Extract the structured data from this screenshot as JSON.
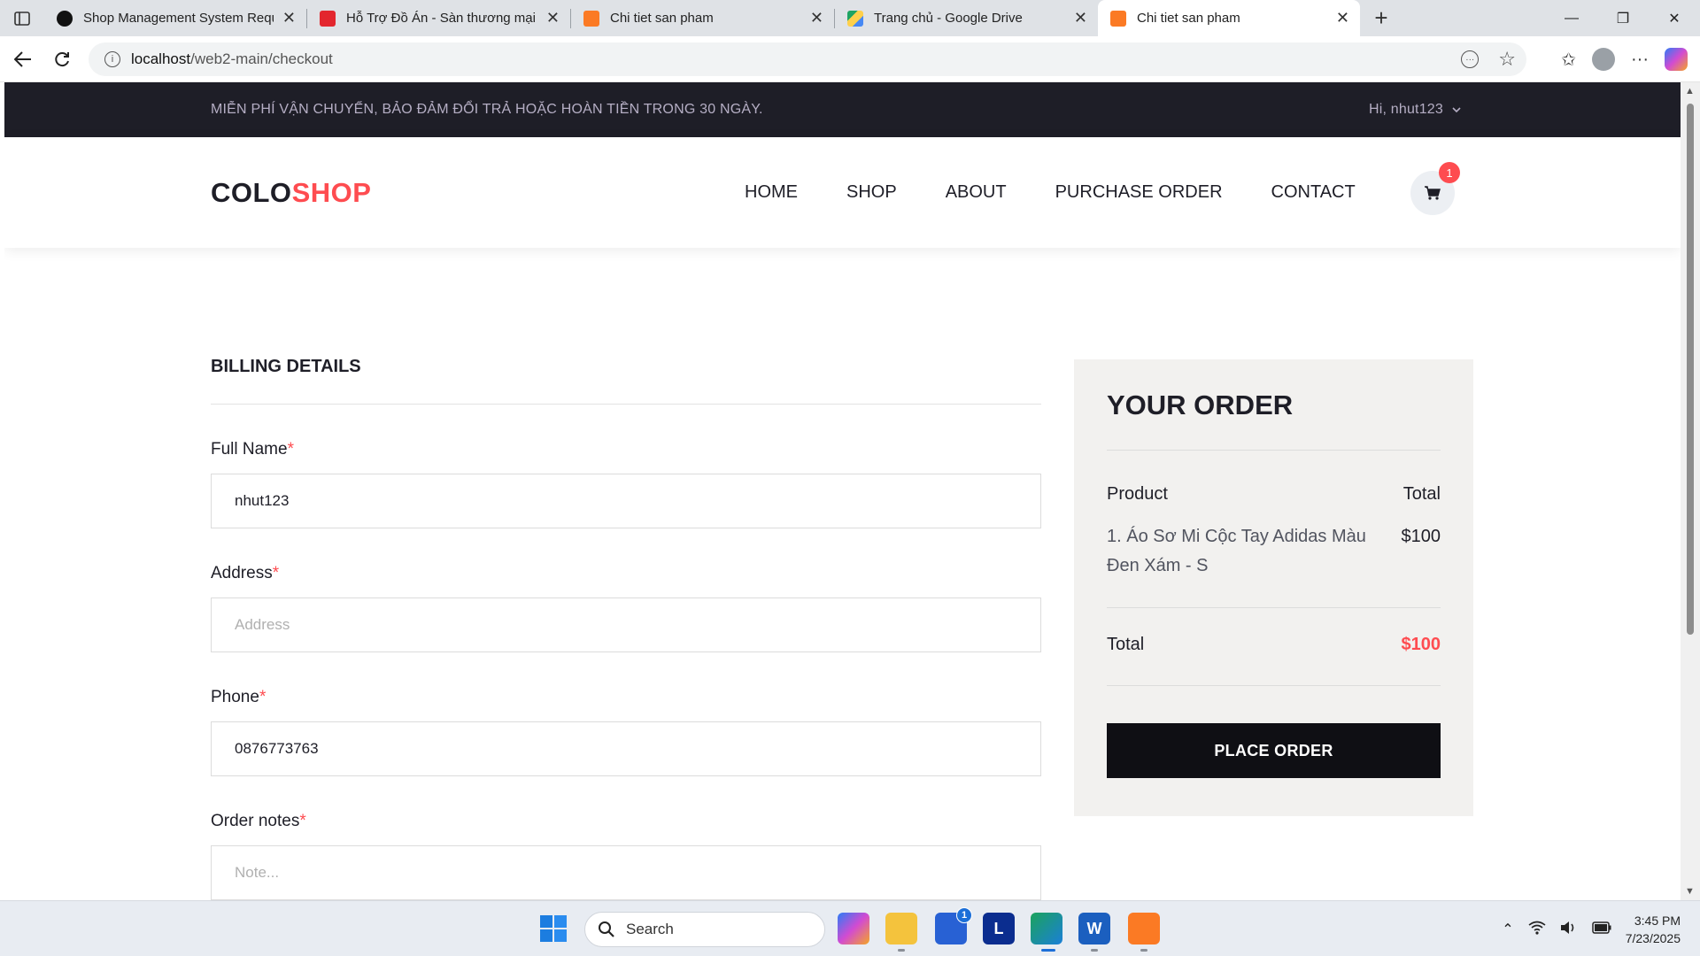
{
  "browser": {
    "tabs": [
      {
        "title": "Shop Management System Requi",
        "favicon_color": "#111111",
        "active": false
      },
      {
        "title": "Hỗ Trợ Đồ Án - Sàn thương mại b",
        "favicon_color": "#e3262e",
        "active": false
      },
      {
        "title": "Chi tiet san pham",
        "favicon_color": "#fb7a24",
        "active": false
      },
      {
        "title": "Trang chủ - Google Drive",
        "favicon_color": "#1fa463",
        "active": false
      },
      {
        "title": "Chi tiet san pham",
        "favicon_color": "#fb7a24",
        "active": true
      }
    ],
    "url_host": "localhost",
    "url_path": "/web2-main/checkout"
  },
  "promo": {
    "text": "MIỄN PHÍ VẬN CHUYỂN, BẢO ĐẢM ĐỔI TRẢ HOẶC HOÀN TIỀN TRONG 30 NGÀY.",
    "greeting": "Hi, nhut123"
  },
  "header": {
    "logo_a": "COLO",
    "logo_b": "SHOP",
    "menu": [
      "HOME",
      "SHOP",
      "ABOUT",
      "PURCHASE ORDER",
      "CONTACT"
    ],
    "cart_count": "1"
  },
  "billing": {
    "title": "BILLING DETAILS",
    "fields": [
      {
        "label": "Full Name",
        "value": "nhut123",
        "placeholder": ""
      },
      {
        "label": "Address",
        "value": "",
        "placeholder": "Address"
      },
      {
        "label": "Phone",
        "value": "0876773763",
        "placeholder": ""
      },
      {
        "label": "Order notes",
        "value": "",
        "placeholder": "Note..."
      }
    ],
    "required_mark": "*"
  },
  "order": {
    "title": "YOUR ORDER",
    "col_product": "Product",
    "col_total": "Total",
    "item_name": "1. Áo Sơ Mi Cộc Tay Adidas Màu Đen Xám - S",
    "item_price": "$100",
    "total_label": "Total",
    "total_value": "$100",
    "button": "PLACE ORDER"
  },
  "taskbar": {
    "search": "Search",
    "store_badge": "1",
    "l_app": "L",
    "time": "3:45 PM",
    "date": "7/23/2025"
  },
  "colors": {
    "accent": "#fe4c50",
    "dark": "#1e1e27"
  }
}
